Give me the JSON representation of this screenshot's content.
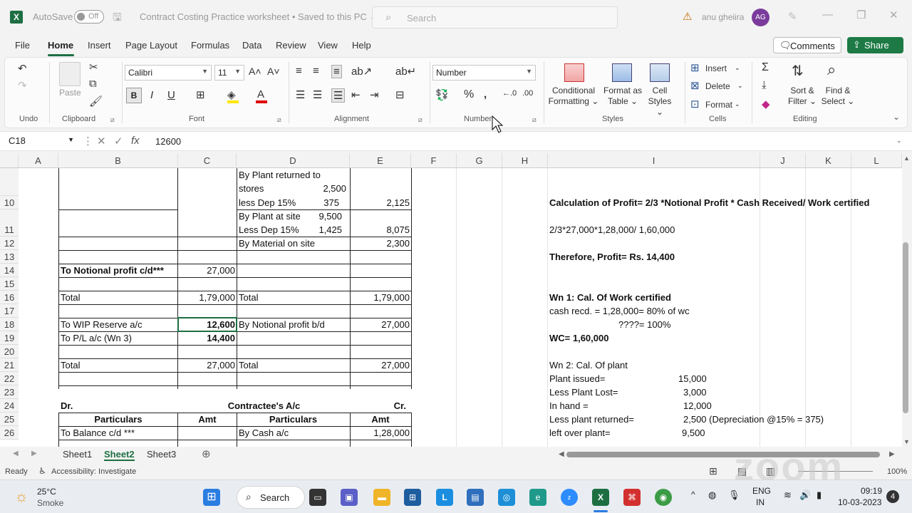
{
  "titlebar": {
    "autosave_label": "AutoSave",
    "autosave_state": "Off",
    "doc_title": "Contract Costing Practice worksheet • Saved to this PC ⌄",
    "search_placeholder": "Search",
    "user_name": "anu gheiira",
    "user_initials": "AG"
  },
  "menu": {
    "tabs": [
      "File",
      "Home",
      "Insert",
      "Page Layout",
      "Formulas",
      "Data",
      "Review",
      "View",
      "Help"
    ],
    "comments_label": "Comments",
    "share_label": "Share"
  },
  "ribbon": {
    "groups": {
      "undo": "Undo",
      "clipboard": "Clipboard",
      "font": "Font",
      "alignment": "Alignment",
      "number": "Number",
      "styles": "Styles",
      "cells": "Cells",
      "editing": "Editing"
    },
    "paste_label": "Paste",
    "font_name": "Calibri",
    "font_size": "11",
    "number_format": "Number",
    "conditional_formatting": [
      "Conditional",
      "Formatting ⌄"
    ],
    "format_as_table": [
      "Format as",
      "Table ⌄"
    ],
    "cell_styles": [
      "Cell",
      "Styles ⌄"
    ],
    "insert_label": "Insert",
    "delete_label": "Delete",
    "format_label": "Format",
    "sort_filter": [
      "Sort &",
      "Filter ⌄"
    ],
    "find_select": [
      "Find &",
      "Select ⌄"
    ]
  },
  "formula_bar": {
    "name_box": "C18",
    "value": "12600"
  },
  "columns": [
    "A",
    "B",
    "C",
    "D",
    "E",
    "F",
    "G",
    "H",
    "I",
    "J",
    "K",
    "L"
  ],
  "rows": [
    "",
    "10",
    "11",
    "12",
    "13",
    "14",
    "15",
    "16",
    "17",
    "18",
    "19",
    "20",
    "21",
    "22",
    "23",
    "24",
    "25",
    "26"
  ],
  "cells": {
    "d_plant_ret": "By Plant returned to",
    "d_stores": "stores",
    "d_stores_amt": "2,500",
    "d_less_dep": "less Dep 15%",
    "d_less_dep_amt": "375",
    "e_10": "2,125",
    "d_plant_site": "By Plant at site",
    "d_plant_site_amt": "9,500",
    "d_less_dep2": "Less Dep 15%",
    "d_less_dep2_amt": "1,425",
    "e_11": "8,075",
    "d_12": "By Material on site",
    "e_12": "2,300",
    "b_14": "To Notional profit c/d***",
    "c_14": "27,000",
    "b_16": "Total",
    "c_16": "1,79,000",
    "d_16": "Total",
    "e_16": "1,79,000",
    "b_18": "To WIP Reserve a/c",
    "c_18": "12,600",
    "d_18": "By Notional profit b/d",
    "e_18": "27,000",
    "b_19": "To P/L a/c (Wn 3)",
    "c_19": "14,400",
    "b_21": "Total",
    "c_21": "27,000",
    "d_21": "Total",
    "e_21": "27,000",
    "b_24": "Dr.",
    "d_24": "Contractee's A/c",
    "e_24": "Cr.",
    "b_25": "Particulars",
    "c_25": "Amt",
    "d_25": "Particulars",
    "e_25": "Amt",
    "b_26": "To Balance c/d ***",
    "d_26": "By Cash a/c",
    "e_26": "1,28,000",
    "i_10": "Calculation of Profit= 2/3 *Notional Profit * Cash Received/ Work certified",
    "i_11": "2/3*27,000*1,28,000/ 1,60,000",
    "i_13": "Therefore, Profit=  Rs. 14,400",
    "i_16": "Wn 1: Cal. Of Work certified",
    "i_17": "cash recd. = 1,28,000= 80% of wc",
    "i_18": "????= 100%",
    "i_19": "WC= 1,60,000",
    "i_21": "Wn 2: Cal. Of plant",
    "i_22": "Plant issued=",
    "i_22v": "15,000",
    "i_23": "Less Plant Lost=",
    "i_23v": "3,000",
    "i_24": "In hand  =",
    "i_24v": "12,000",
    "i_25": "Less plant returned=",
    "i_25v": "2,500 (Depreciation @15% = 375)",
    "i_26": "left over plant=",
    "i_26v": "9,500"
  },
  "sheets": [
    "Sheet1",
    "Sheet2",
    "Sheet3"
  ],
  "status": {
    "ready": "Ready",
    "accessibility": "Accessibility: Investigate",
    "zoom": "100%"
  },
  "taskbar": {
    "weather_temp": "25°C",
    "weather_desc": "Smoke",
    "search_label": "Search",
    "lang1": "ENG",
    "lang2": "IN",
    "time": "09:19",
    "date": "10-03-2023",
    "notif": "4"
  }
}
